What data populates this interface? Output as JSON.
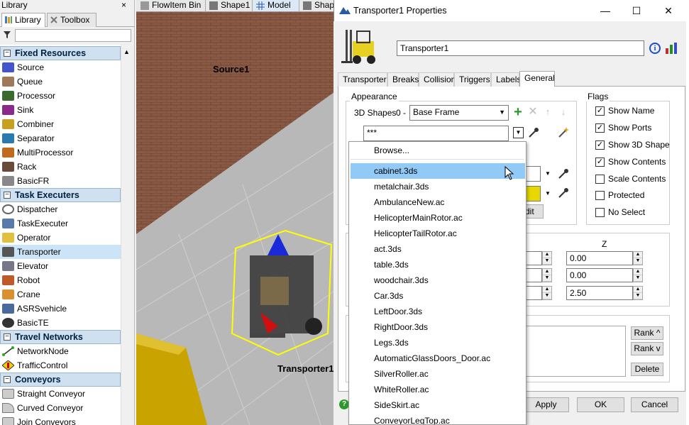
{
  "library": {
    "title": "Library",
    "close": "×",
    "tabs": [
      {
        "label": "Library"
      },
      {
        "label": "Toolbox"
      }
    ],
    "filter_value": "",
    "categories": [
      {
        "label": "Fixed Resources",
        "items": [
          "Source",
          "Queue",
          "Processor",
          "Sink",
          "Combiner",
          "Separator",
          "MultiProcessor",
          "Rack",
          "BasicFR"
        ]
      },
      {
        "label": "Task Executers",
        "items": [
          "Dispatcher",
          "TaskExecuter",
          "Operator",
          "Transporter",
          "Elevator",
          "Robot",
          "Crane",
          "ASRSvehicle",
          "BasicTE"
        ]
      },
      {
        "label": "Travel Networks",
        "items": [
          "NetworkNode",
          "TrafficControl"
        ]
      },
      {
        "label": "Conveyors",
        "items": [
          "Straight Conveyor",
          "Curved Conveyor",
          "Join Conveyors"
        ]
      }
    ],
    "collapse_glyph": "−",
    "selected_item": "Transporter"
  },
  "view": {
    "tabs": [
      {
        "label": "FlowItem Bin"
      },
      {
        "label": "Shape1"
      },
      {
        "label": "Model"
      },
      {
        "label": "Shap"
      }
    ],
    "labels": {
      "source": "Source1",
      "transporter": "Transporter1"
    }
  },
  "window": {
    "title": "Transporter1  Properties",
    "buttons": {
      "minimize": "—",
      "maximize": "☐",
      "close": "✕"
    },
    "name_value": "Transporter1",
    "info_glyph": "i",
    "tabs": [
      "Transporter",
      "Breaks",
      "Collision",
      "Triggers",
      "Labels",
      "General"
    ],
    "active_tab": "General",
    "appearance": {
      "group_label": "Appearance",
      "shapes_label": "3D Shapes",
      "shape_index": "0 -",
      "shape_select": "Base Frame",
      "shape_file": "***",
      "edit_fragment": "dit"
    },
    "flags": {
      "group_label": "Flags",
      "items": [
        {
          "label": "Show Name",
          "checked": true
        },
        {
          "label": "Show Ports",
          "checked": true
        },
        {
          "label": "Show 3D Shape",
          "checked": true
        },
        {
          "label": "Show Contents",
          "checked": true
        },
        {
          "label": "Scale Contents",
          "checked": false
        },
        {
          "label": "Protected",
          "checked": false
        },
        {
          "label": "No Select",
          "checked": false
        }
      ]
    },
    "position": {
      "z_header": "Z",
      "z_values": [
        "0.00",
        "0.00",
        "2.50"
      ]
    },
    "rank_buttons": [
      "Rank ^",
      "Rank v",
      "Delete"
    ],
    "footer": {
      "apply": "Apply",
      "ok": "OK",
      "cancel": "Cancel"
    }
  },
  "dropdown": {
    "items": [
      "Browse...",
      "cabinet.3ds",
      "metalchair.3ds",
      "AmbulanceNew.ac",
      "HelicopterMainRotor.ac",
      "HelicopterTailRotor.ac",
      "act.3ds",
      "table.3ds",
      "woodchair.3ds",
      "Car.3ds",
      "LeftDoor.3ds",
      "RightDoor.3ds",
      "Legs.3ds",
      "AutomaticGlassDoors_Door.ac",
      "SilverRoller.ac",
      "WhiteRoller.ac",
      "SideSkirt.ac",
      "ConveyorLegTop.ac"
    ],
    "highlighted": "cabinet.3ds"
  },
  "colors": {
    "accent": "#91c9f7",
    "category_bg": "#cfe0f0",
    "selection": "#cce4f7"
  }
}
